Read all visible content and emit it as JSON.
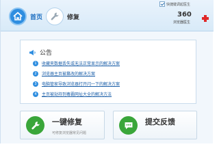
{
  "toolbar": {
    "tabs": [
      {
        "label": "首页",
        "icon": "home-icon",
        "active": true
      },
      {
        "label": "修复",
        "icon": "wrench-icon",
        "active": false
      }
    ],
    "auto_doctor_checkbox": {
      "label": "快捷键调起医生",
      "checked": true
    },
    "brand": {
      "number": "360",
      "name": "浏览器医生",
      "icon": "red-cross-icon"
    }
  },
  "notice": {
    "title": "公告",
    "icon": "megaphone-icon",
    "items": [
      {
        "num": "1",
        "text": "收藏夹数据丢失或无法正常显示的解决方案"
      },
      {
        "num": "2",
        "text": "浏览器主页被篡改的解决方案"
      },
      {
        "num": "3",
        "text": "电脑管家导致浏览器打开闪一下的解决方案"
      },
      {
        "num": "4",
        "text": "主页被劫持到毒霸网址大全的解决方法"
      }
    ]
  },
  "actions": {
    "fix": {
      "title": "一键修复",
      "subtitle": "可修复浏览器常见问题",
      "icon": "wrench-icon"
    },
    "feedback": {
      "title": "提交反馈",
      "subtitle": "",
      "icon": "chat-bubble-icon"
    }
  },
  "colors": {
    "accent": "#2f8ee0",
    "link": "#1a5ea8",
    "action_icon": "#3aa63a",
    "brand_cross": "#e02828"
  }
}
